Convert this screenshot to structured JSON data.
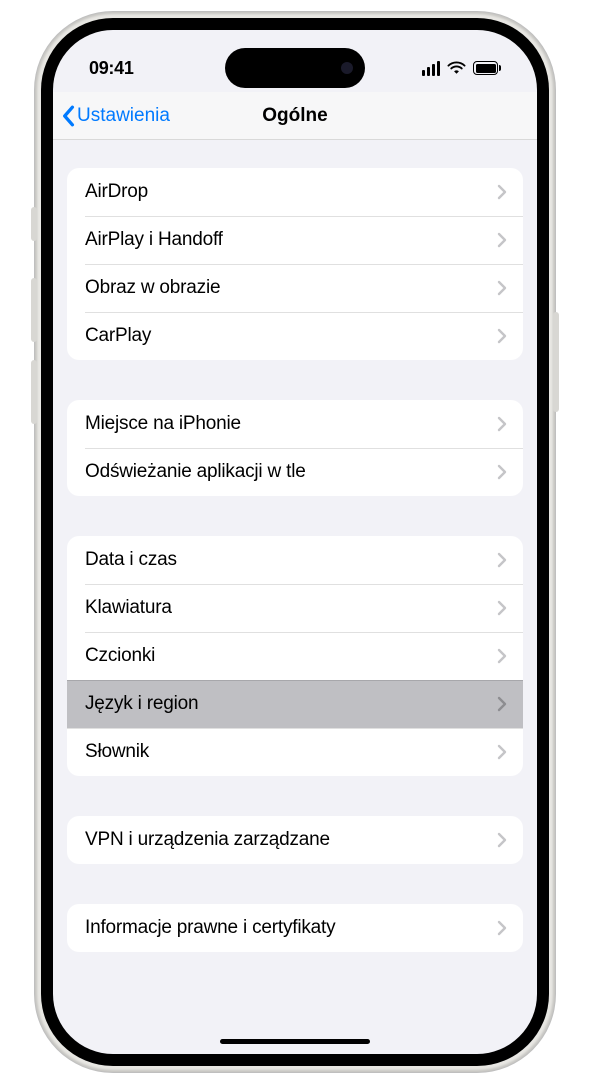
{
  "status": {
    "time": "09:41"
  },
  "nav": {
    "back": "Ustawienia",
    "title": "Ogólne"
  },
  "groups": {
    "g1": [
      {
        "label": "AirDrop",
        "name": "row-airdrop"
      },
      {
        "label": "AirPlay i Handoff",
        "name": "row-airplay-handoff"
      },
      {
        "label": "Obraz w obrazie",
        "name": "row-pip"
      },
      {
        "label": "CarPlay",
        "name": "row-carplay"
      }
    ],
    "g2": [
      {
        "label": "Miejsce na iPhonie",
        "name": "row-storage"
      },
      {
        "label": "Odświeżanie aplikacji w tle",
        "name": "row-background-refresh"
      }
    ],
    "g3": [
      {
        "label": "Data i czas",
        "name": "row-date-time"
      },
      {
        "label": "Klawiatura",
        "name": "row-keyboard"
      },
      {
        "label": "Czcionki",
        "name": "row-fonts"
      },
      {
        "label": "Język i region",
        "name": "row-language-region",
        "highlighted": true
      },
      {
        "label": "Słownik",
        "name": "row-dictionary"
      }
    ],
    "g4": [
      {
        "label": "VPN i urządzenia zarządzane",
        "name": "row-vpn-managed"
      }
    ],
    "g5": [
      {
        "label": "Informacje prawne i certyfikaty",
        "name": "row-legal"
      }
    ]
  }
}
